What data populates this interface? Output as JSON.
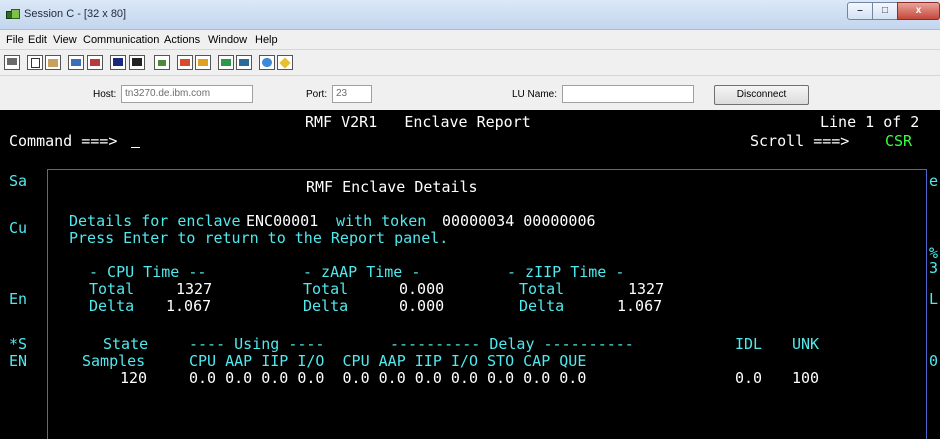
{
  "window": {
    "title": "Session C - [32 x 80]",
    "controls": {
      "minimize": "–",
      "maximize": "□",
      "close": "x"
    }
  },
  "menu": [
    "File",
    "Edit",
    "View",
    "Communication",
    "Actions",
    "Window",
    "Help"
  ],
  "toolbar_icons": [
    "display-icon",
    "copy-icon",
    "paste-icon",
    "send-icon",
    "receive-icon",
    "screen-icon",
    "print-screen-icon",
    "chart-icon",
    "macro-record-icon",
    "macro-play-icon",
    "transfer-icon",
    "transfer-multi-icon",
    "palette-icon",
    "edit-icon"
  ],
  "connection": {
    "host_label": "Host:",
    "host_value": "tn3270.de.ibm.com",
    "port_label": "Port:",
    "port_value": "23",
    "lu_label": "LU Name:",
    "lu_value": "",
    "disconnect_label": "Disconnect"
  },
  "screen": {
    "header": "RMF V2R1   Enclave Report",
    "line_info": "Line 1 of 2",
    "command_prompt": "Command ===>",
    "command_value": " ",
    "scroll_prompt": "Scroll ===>",
    "scroll_value": "CSR",
    "bg_left": [
      "Sa",
      "Cu",
      "En",
      "*S",
      "EN"
    ],
    "bg_right": [
      "e",
      "%",
      "3",
      "L",
      "0"
    ]
  },
  "popup": {
    "title": "RMF Enclave Details",
    "details_prefix": "Details for enclave",
    "enclave": "ENC00001",
    "token_prefix": "with token",
    "token": "00000034 00000006",
    "instruction": "Press Enter to return to the Report panel.",
    "cpu": {
      "heading": "- CPU Time --",
      "total_label": "Total",
      "total": "1327",
      "delta_label": "Delta",
      "delta": "1.067"
    },
    "zaap": {
      "heading": "- zAAP Time -",
      "total_label": "Total",
      "total": "0.000",
      "delta_label": "Delta",
      "delta": "0.000"
    },
    "ziip": {
      "heading": "- zIIP Time -",
      "total_label": "Total",
      "total": "1327",
      "delta_label": "Delta",
      "delta": "1.067"
    },
    "state": {
      "state_label": "State",
      "using_header": "---- Using ----",
      "delay_header": "---------- Delay ----------",
      "idl_header": "IDL",
      "unk_header": "UNK",
      "samples_label": "Samples",
      "columns": "CPU AAP IIP I/O  CPU AAP IIP I/O STO CAP QUE",
      "samples": "120",
      "values": "0.0 0.0 0.0 0.0  0.0 0.0 0.0 0.0 0.0 0.0 0.0",
      "idl": "0.0",
      "unk": "100"
    }
  }
}
